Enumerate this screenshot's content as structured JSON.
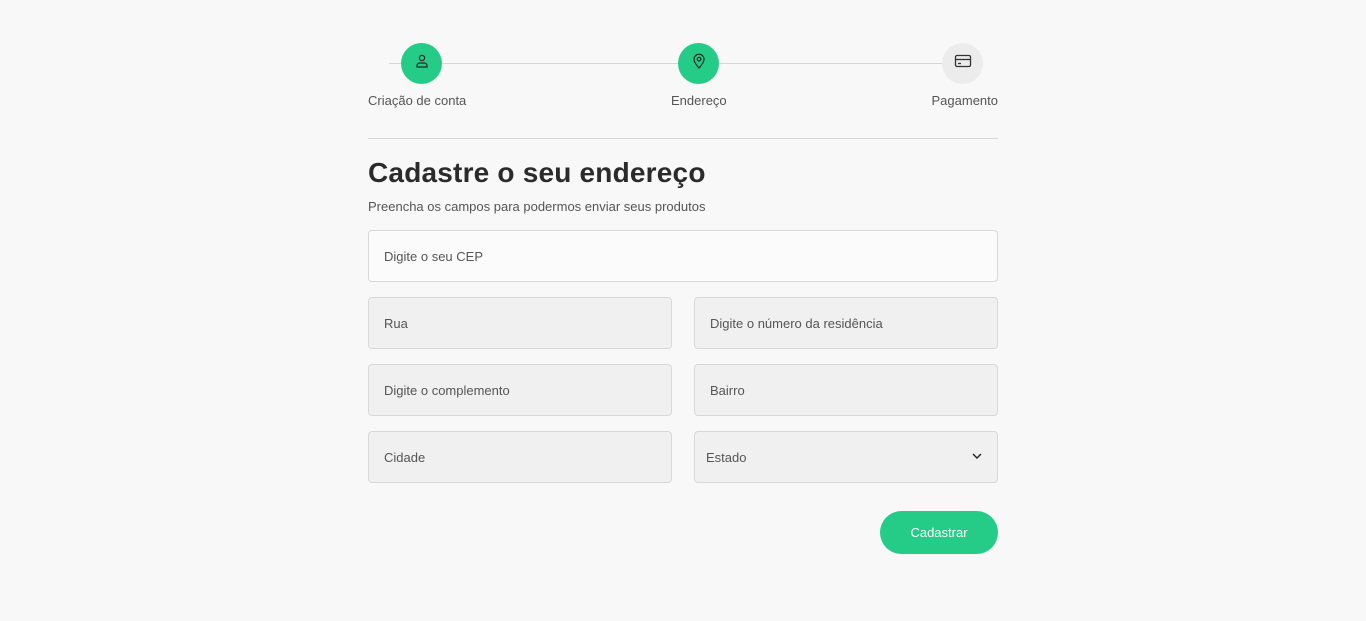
{
  "stepper": {
    "steps": [
      {
        "label": "Criação de conta",
        "icon": "user-icon",
        "state": "active"
      },
      {
        "label": "Endereço",
        "icon": "map-pin-icon",
        "state": "active"
      },
      {
        "label": "Pagamento",
        "icon": "credit-card-icon",
        "state": "inactive"
      }
    ]
  },
  "form": {
    "title": "Cadastre o seu endereço",
    "subtitle": "Preencha os campos para podermos enviar seus produtos",
    "cep_placeholder": "Digite o seu CEP",
    "rua_placeholder": "Rua",
    "numero_placeholder": "Digite o número da residência",
    "complemento_placeholder": "Digite o complemento",
    "bairro_placeholder": "Bairro",
    "cidade_placeholder": "Cidade",
    "estado_selected": "Estado",
    "submit_label": "Cadastrar"
  },
  "colors": {
    "accent": "#24cc87",
    "background": "#f8f8f8",
    "inactive_step": "#ececec"
  }
}
